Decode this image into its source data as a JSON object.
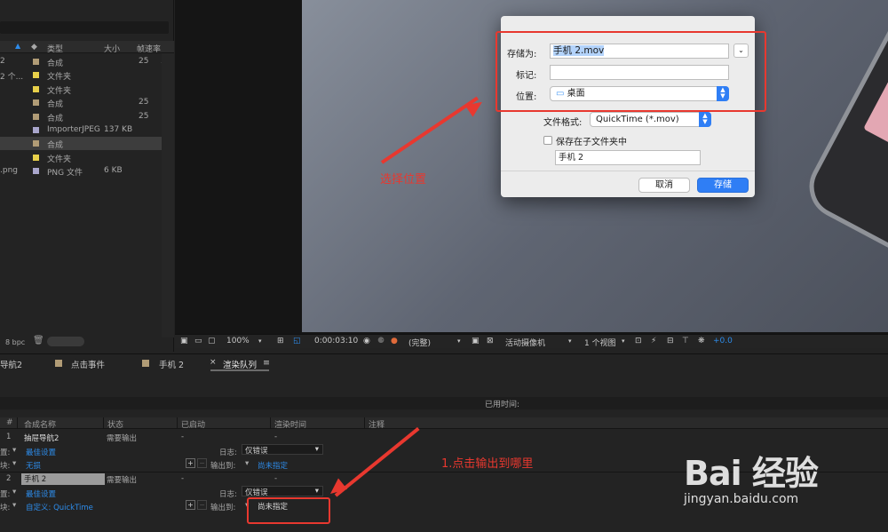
{
  "project": {
    "columns": [
      "类型",
      "大小",
      "帧速率"
    ],
    "rows": [
      {
        "left": "2",
        "color": "#b19c76",
        "type": "合成",
        "size": "",
        "fps": "25",
        "icon": true,
        "selected": false
      },
      {
        "left": "2 个...",
        "color": "#e8d04a",
        "type": "文件夹",
        "size": "",
        "fps": "",
        "icon": false,
        "selected": false
      },
      {
        "left": "",
        "color": "#e8d04a",
        "type": "文件夹",
        "size": "",
        "fps": "",
        "icon": false,
        "selected": false
      },
      {
        "left": "",
        "color": "#b19c76",
        "type": "合成",
        "size": "",
        "fps": "25",
        "icon": false,
        "selected": false
      },
      {
        "left": "",
        "color": "#b19c76",
        "type": "合成",
        "size": "",
        "fps": "25",
        "icon": false,
        "selected": false
      },
      {
        "left": "",
        "color": "#a9a6cc",
        "type": "ImporterJPEG",
        "size": "137 KB",
        "fps": "",
        "icon": false,
        "selected": false
      },
      {
        "left": "",
        "color": "#b19c76",
        "type": "合成",
        "size": "",
        "fps": "",
        "icon": false,
        "selected": true
      },
      {
        "left": "",
        "color": "#e8d04a",
        "type": "文件夹",
        "size": "",
        "fps": "",
        "icon": false,
        "selected": false
      },
      {
        "left": ".png",
        "color": "#a9a6cc",
        "type": "PNG 文件",
        "size": "6 KB",
        "fps": "",
        "icon": false,
        "selected": false
      }
    ],
    "bpc": "8 bpc"
  },
  "viewer_toolbar": {
    "zoom": "100%",
    "timecode": "0:00:03:10",
    "resolution": "(完整)",
    "camera": "活动摄像机",
    "views": "1 个视图",
    "exposure": "+0.0"
  },
  "tabs": [
    {
      "label": "导航2",
      "color": ""
    },
    {
      "label": "点击事件",
      "color": "#b19c76"
    },
    {
      "label": "手机 2",
      "color": "#b19c76"
    },
    {
      "label": "渲染队列",
      "color": "",
      "active": true
    }
  ],
  "render_queue": {
    "elapsed_label": "已用时间:",
    "columns": [
      "#",
      "合成名称",
      "状态",
      "已启动",
      "渲染时间",
      "注释"
    ],
    "items": [
      {
        "num": "1",
        "name": "抽屉导航2",
        "status": "需要输出",
        "started": "-",
        "render_time": "-",
        "settings": "最佳设置",
        "log_label": "日志:",
        "log": "仅错误",
        "output_module": "无损",
        "output_to_label": "输出到:",
        "output_to": "尚未指定"
      },
      {
        "num": "2",
        "name": "手机 2",
        "status": "需要输出",
        "started": "-",
        "render_time": "-",
        "settings": "最佳设置",
        "log_label": "日志:",
        "log": "仅错误",
        "output_module": "自定义: QuickTime",
        "output_to_label": "输出到:",
        "output_to": "尚未指定"
      }
    ],
    "settings_prefix": "置:",
    "module_prefix": "块:"
  },
  "save_dialog": {
    "save_as_label": "存储为:",
    "filename": "手机 2.mov",
    "tags_label": "标记:",
    "tags_value": "",
    "where_label": "位置:",
    "where_value": "桌面",
    "format_label": "文件格式:",
    "format_value": "QuickTime (*.mov)",
    "subfolder_label": "保存在子文件夹中",
    "subfolder_checked": false,
    "subfolder_name": "手机 2",
    "cancel": "取消",
    "save": "存储"
  },
  "annotations": {
    "choose_location": "选择位置",
    "click_output": "1.点击输出到哪里"
  },
  "watermark": {
    "brand": "Bai 经验",
    "url": "jingyan.baidu.com"
  },
  "colors": {
    "accent_blue": "#2d8ceb",
    "annotation_red": "#e8382f",
    "comp_label": "#b19c76",
    "folder_label": "#e8d04a",
    "file_label": "#a9a6cc"
  }
}
